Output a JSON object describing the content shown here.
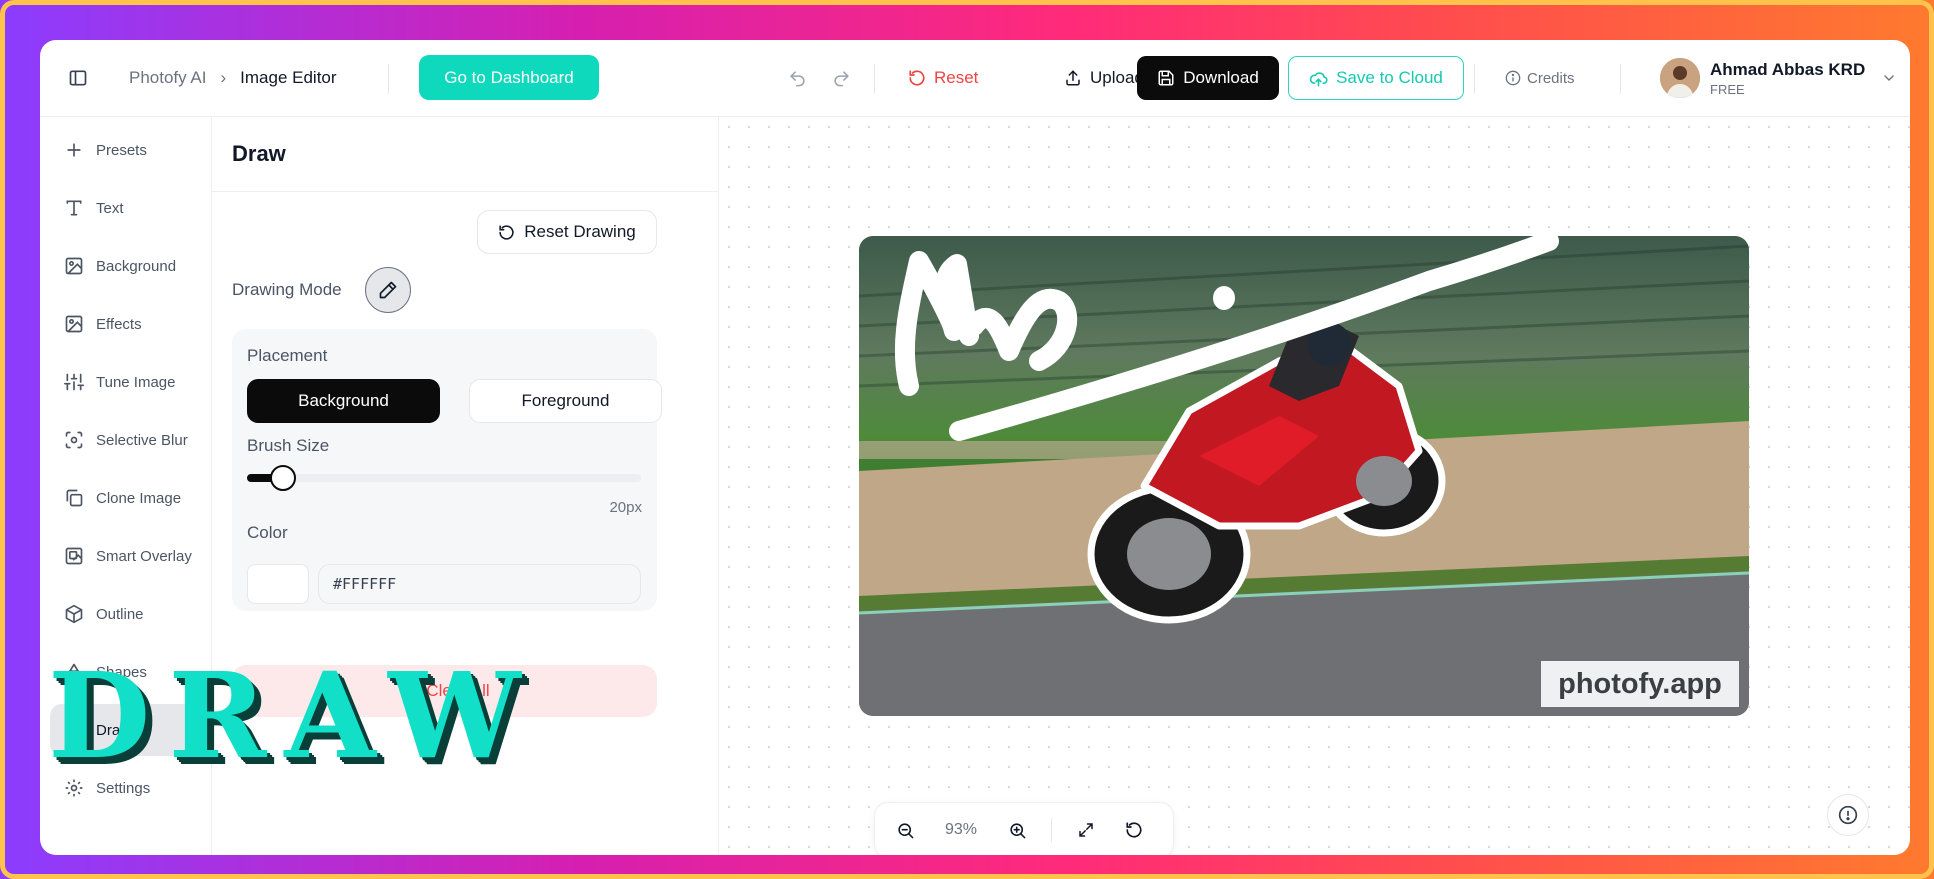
{
  "breadcrumb": {
    "app": "Photofy AI",
    "separator": "›",
    "current": "Image Editor"
  },
  "header": {
    "dashboard_label": "Go to Dashboard",
    "reset_label": "Reset",
    "upload_label": "Upload",
    "download_label": "Download",
    "save_cloud_label": "Save to Cloud",
    "credits_label": "Credits",
    "user_name": "Ahmad Abbas KRD",
    "user_plan": "FREE"
  },
  "sidebar": {
    "items": [
      {
        "label": "Presets",
        "icon": "plus-icon"
      },
      {
        "label": "Text",
        "icon": "text-icon"
      },
      {
        "label": "Background",
        "icon": "image-icon"
      },
      {
        "label": "Effects",
        "icon": "effects-icon"
      },
      {
        "label": "Tune Image",
        "icon": "sliders-icon"
      },
      {
        "label": "Selective Blur",
        "icon": "focus-icon"
      },
      {
        "label": "Clone Image",
        "icon": "copy-icon"
      },
      {
        "label": "Smart Overlay",
        "icon": "overlay-icon"
      },
      {
        "label": "Outline",
        "icon": "cube-icon"
      },
      {
        "label": "Shapes",
        "icon": "shapes-icon"
      },
      {
        "label": "Draw",
        "icon": "pencil-icon",
        "active": true
      },
      {
        "label": "Settings",
        "icon": "gear-icon"
      }
    ]
  },
  "panel": {
    "title": "Draw",
    "reset_drawing_label": "Reset Drawing",
    "drawing_mode_label": "Drawing Mode",
    "placement_label": "Placement",
    "placement_options": [
      "Background",
      "Foreground"
    ],
    "placement_selected": "Background",
    "brush_size_label": "Brush Size",
    "brush_size_value": "20px",
    "brush_size_fraction": 0.05,
    "color_label": "Color",
    "color_value": "#FFFFFF",
    "clear_all_label": "Clear All"
  },
  "overlay_text": "DRAW",
  "canvas": {
    "watermark": "photofy.app",
    "zoom_label": "93%"
  },
  "colors": {
    "accent": "#0fd9bd",
    "danger": "#ef4444",
    "dark": "#0b0b0b",
    "brush": "#FFFFFF"
  }
}
